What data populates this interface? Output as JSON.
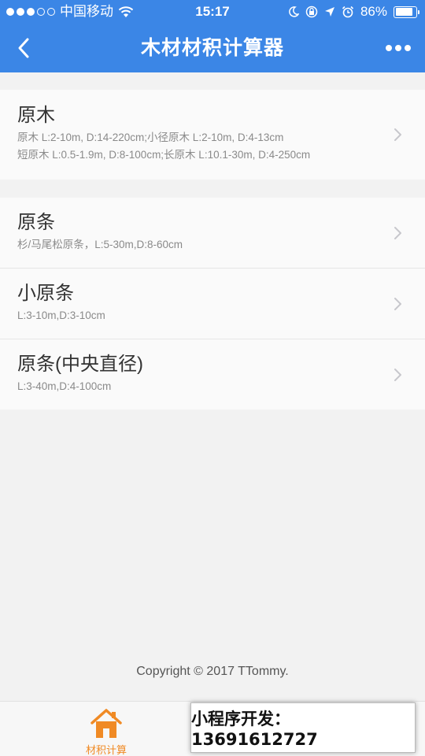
{
  "status_bar": {
    "carrier": "中国移动",
    "time": "15:17",
    "battery": "86%",
    "battery_level": 0.86
  },
  "nav": {
    "title": "木材材积计算器"
  },
  "groups": [
    {
      "items": [
        {
          "name": "原木",
          "desc": [
            "原木 L:2-10m, D:14-220cm;小径原木 L:2-10m, D:4-13cm",
            "短原木 L:0.5-1.9m, D:8-100cm;长原木 L:10.1-30m, D:4-250cm"
          ]
        }
      ]
    },
    {
      "items": [
        {
          "name": "原条",
          "desc": [
            "杉/马尾松原条，L:5-30m,D:8-60cm"
          ]
        },
        {
          "name": "小原条",
          "desc": [
            "L:3-10m,D:3-10cm"
          ]
        },
        {
          "name": "原条(中央直径)",
          "desc": [
            "L:3-40m,D:4-100cm"
          ]
        }
      ]
    }
  ],
  "footer": {
    "copyright": "Copyright © 2017 TTommy."
  },
  "tabbar": {
    "tabs": [
      {
        "label": "材积计算",
        "icon": "home-icon",
        "active": true
      },
      {
        "label": "",
        "icon": "tab-icon",
        "active": false
      }
    ]
  },
  "overlay": {
    "text": "小程序开发：13691612727"
  },
  "colors": {
    "nav_bg": "#3b86e6",
    "accent": "#f08a24",
    "page_bg": "#f2f2f2"
  }
}
